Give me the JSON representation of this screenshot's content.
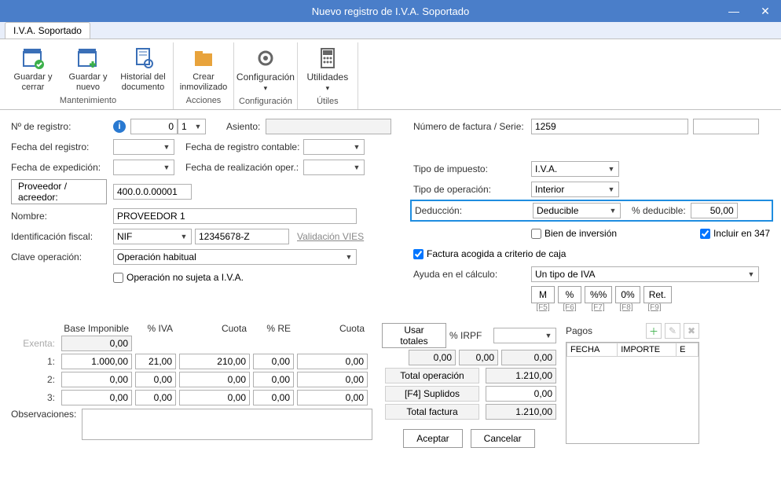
{
  "window": {
    "title": "Nuevo registro de I.V.A. Soportado"
  },
  "tab": {
    "main": "I.V.A. Soportado"
  },
  "ribbon": {
    "maintain": {
      "save_close": "Guardar y cerrar",
      "save_new": "Guardar y nuevo",
      "history": "Historial del documento",
      "group": "Mantenimiento"
    },
    "actions": {
      "create_fixed": "Crear inmovilizado",
      "group": "Acciones"
    },
    "config": {
      "config": "Configuración",
      "group": "Configuración"
    },
    "utils": {
      "util": "Utilidades",
      "group": "Útiles"
    }
  },
  "left": {
    "regnum": "Nº de registro:",
    "regnum_a": "0",
    "regnum_b": "1",
    "asiento": "Asiento:",
    "fecha_reg": "Fecha del registro:",
    "fecha_reg_cont": "Fecha de registro contable:",
    "fecha_exp": "Fecha de expedición:",
    "fecha_real": "Fecha de realización oper.:",
    "prov_btn": "Proveedor / acreedor:",
    "prov_val": "400.0.0.00001",
    "nombre": "Nombre:",
    "nombre_val": "PROVEEDOR 1",
    "id_fiscal": "Identificación fiscal:",
    "id_fiscal_type": "NIF",
    "id_fiscal_val": "12345678-Z",
    "vies": "Validación VIES",
    "clave_op": "Clave operación:",
    "clave_op_val": "Operación habitual",
    "no_sujeta": "Operación no sujeta a I.V.A."
  },
  "right": {
    "numfact": "Número de factura / Serie:",
    "numfact_val": "1259",
    "tipo_imp": "Tipo de impuesto:",
    "tipo_imp_val": "I.V.A.",
    "tipo_op": "Tipo de operación:",
    "tipo_op_val": "Interior",
    "deduccion": "Deducción:",
    "deduccion_val": "Deducible",
    "pct_ded": "% deducible:",
    "pct_ded_val": "50,00",
    "bien_inv": "Bien de inversión",
    "incl_347": "Incluir en 347",
    "crit_caja": "Factura acogida a criterio de caja",
    "ayuda_calc": "Ayuda en el cálculo:",
    "ayuda_calc_val": "Un tipo de IVA",
    "calc_btns": {
      "m": "M",
      "pct": "%",
      "pctpct": "%%",
      "zero": "0%",
      "ret": "Ret."
    },
    "calc_hints": {
      "f5": "[F5]",
      "f6": "[F6]",
      "f7": "[F7]",
      "f8": "[F8]",
      "f9": "[F9]"
    }
  },
  "grid": {
    "head": {
      "base": "Base Imponible",
      "iva": "% IVA",
      "cuota1": "Cuota",
      "re": "% RE",
      "cuota2": "Cuota",
      "usartot": "Usar totales",
      "irpf": "% IRPF"
    },
    "rows": {
      "exenta": {
        "lbl": "Exenta:",
        "base": "0,00"
      },
      "r1": {
        "lbl": "1:",
        "base": "1.000,00",
        "iva": "21,00",
        "cuota1": "210,00",
        "re": "0,00",
        "cuota2": "0,00"
      },
      "r2": {
        "lbl": "2:",
        "base": "0,00",
        "iva": "0,00",
        "cuota1": "0,00",
        "re": "0,00",
        "cuota2": "0,00"
      },
      "r3": {
        "lbl": "3:",
        "base": "0,00",
        "iva": "0,00",
        "cuota1": "0,00",
        "re": "0,00",
        "cuota2": "0,00"
      }
    },
    "irpf": {
      "a": "0,00",
      "b": "0,00",
      "c": "0,00"
    },
    "totals": {
      "total_op_lbl": "Total operación",
      "total_op": "1.210,00",
      "suplidos_lbl": "[F4] Suplidos",
      "suplidos": "0,00",
      "total_fact_lbl": "Total factura",
      "total_fact": "1.210,00"
    },
    "pagos": {
      "title": "Pagos",
      "fecha": "FECHA",
      "importe": "IMPORTE",
      "e": "E"
    },
    "observ": "Observaciones:"
  },
  "footer": {
    "aceptar": "Aceptar",
    "cancelar": "Cancelar"
  }
}
